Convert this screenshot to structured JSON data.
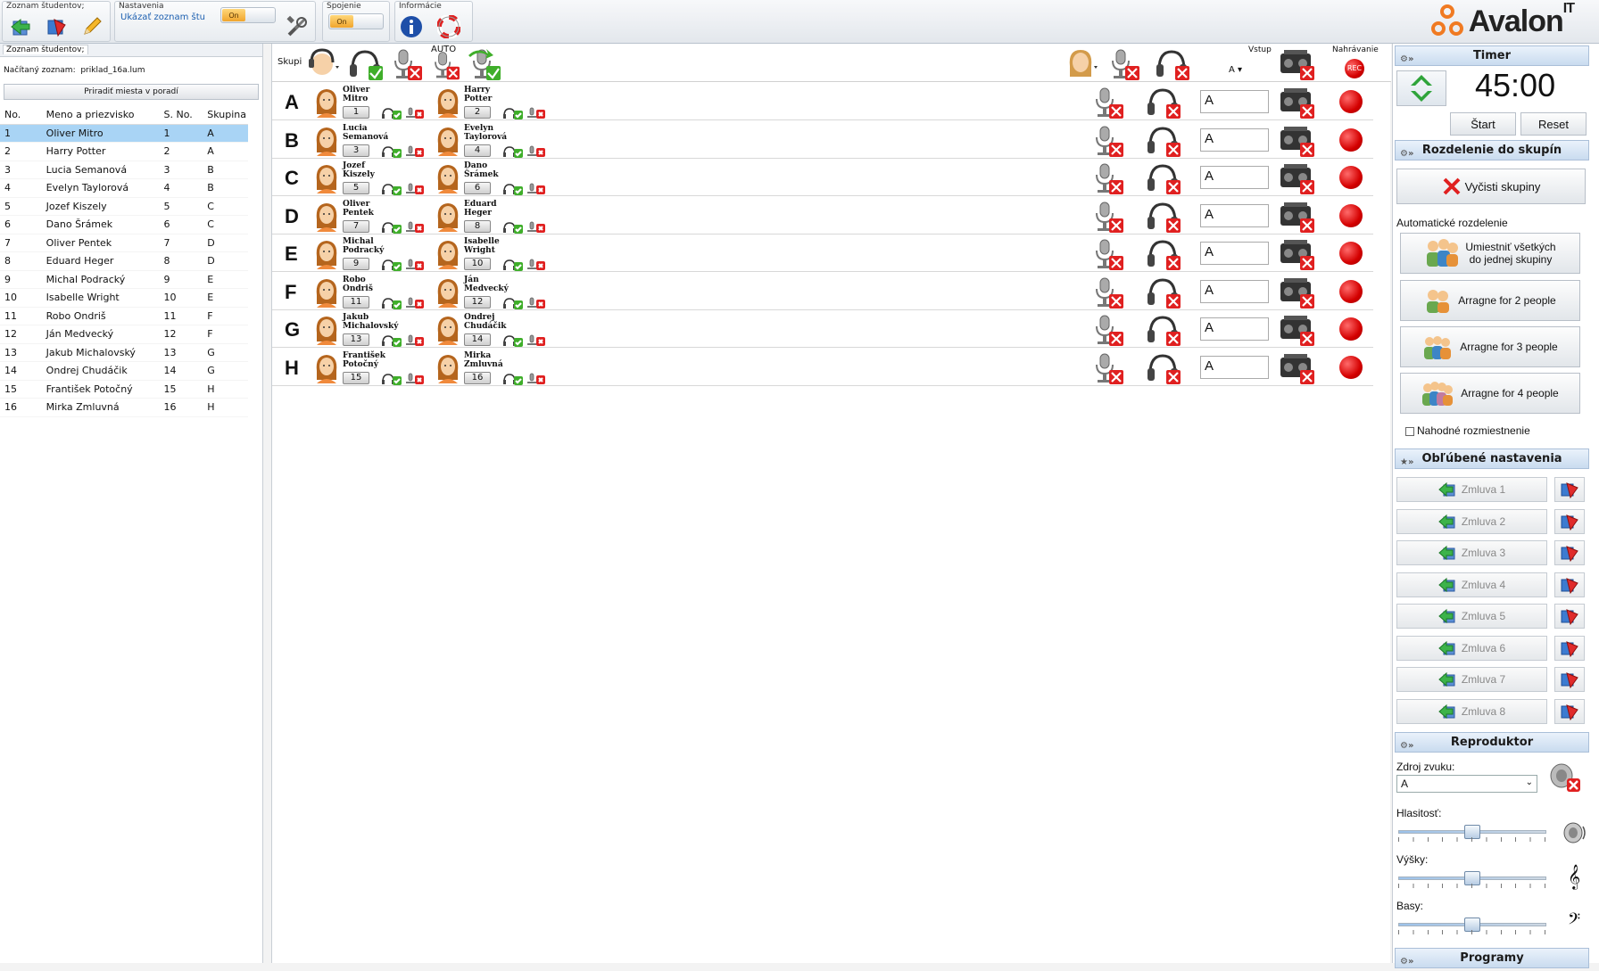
{
  "toolbar": {
    "students_group": "Zoznam študentov;",
    "settings_group": "Nastavenia",
    "show_list_label": "Ukázať zoznam štu",
    "toggle_on": "On",
    "connection_group": "Spojenie",
    "info_group": "Informácie"
  },
  "logo": {
    "text": "Avalon",
    "sup": "IT"
  },
  "left": {
    "tab": "Zoznam študentov;",
    "loaded_label": "Načítaný zoznam:",
    "loaded_file": "priklad_16a.lum",
    "arrange_button": "Priradiť miesta v poradí",
    "columns": [
      "No.",
      "Meno a priezvisko",
      "S. No.",
      "Skupina"
    ],
    "rows": [
      [
        "1",
        "Oliver Mitro",
        "1",
        "A"
      ],
      [
        "2",
        "Harry Potter",
        "2",
        "A"
      ],
      [
        "3",
        "Lucia Semanová",
        "3",
        "B"
      ],
      [
        "4",
        "Evelyn Taylorová",
        "4",
        "B"
      ],
      [
        "5",
        "Jozef Kiszely",
        "5",
        "C"
      ],
      [
        "6",
        "Dano Šrámek",
        "6",
        "C"
      ],
      [
        "7",
        "Oliver Pentek",
        "7",
        "D"
      ],
      [
        "8",
        "Eduard Heger",
        "8",
        "D"
      ],
      [
        "9",
        "Michal Podracký",
        "9",
        "E"
      ],
      [
        "10",
        "Isabelle Wright",
        "10",
        "E"
      ],
      [
        "11",
        "Robo Ondriš",
        "11",
        "F"
      ],
      [
        "12",
        "Ján Medvecký",
        "12",
        "F"
      ],
      [
        "13",
        "Jakub Michalovský",
        "13",
        "G"
      ],
      [
        "14",
        "Ondrej Chudáčik",
        "14",
        "G"
      ],
      [
        "15",
        "František Potočný",
        "15",
        "H"
      ],
      [
        "16",
        "Mirka Zmluvná",
        "16",
        "H"
      ]
    ]
  },
  "center": {
    "groups_label": "Skupi",
    "auto_label": "AUTO",
    "input_label": "Vstup",
    "input_value": "A",
    "recording_label": "Nahrávanie",
    "rec_text": "REC",
    "groups": [
      {
        "letter": "A",
        "a_name1": "Oliver",
        "a_name2": "Mitro",
        "a_num": "1",
        "b_name1": "Harry",
        "b_name2": "Potter",
        "b_num": "2",
        "input": "A"
      },
      {
        "letter": "B",
        "a_name1": "Lucia",
        "a_name2": "Semanová",
        "a_num": "3",
        "b_name1": "Evelyn",
        "b_name2": "Taylorová",
        "b_num": "4",
        "input": "A"
      },
      {
        "letter": "C",
        "a_name1": "Jozef",
        "a_name2": "Kiszely",
        "a_num": "5",
        "b_name1": "Dano",
        "b_name2": "Šrámek",
        "b_num": "6",
        "input": "A"
      },
      {
        "letter": "D",
        "a_name1": "Oliver",
        "a_name2": "Pentek",
        "a_num": "7",
        "b_name1": "Eduard",
        "b_name2": "Heger",
        "b_num": "8",
        "input": "A"
      },
      {
        "letter": "E",
        "a_name1": "Michal",
        "a_name2": "Podracký",
        "a_num": "9",
        "b_name1": "Isabelle",
        "b_name2": "Wright",
        "b_num": "10",
        "input": "A"
      },
      {
        "letter": "F",
        "a_name1": "Robo",
        "a_name2": "Ondriš",
        "a_num": "11",
        "b_name1": "Ján",
        "b_name2": "Medvecký",
        "b_num": "12",
        "input": "A"
      },
      {
        "letter": "G",
        "a_name1": "Jakub",
        "a_name2": "Michalovský",
        "a_num": "13",
        "b_name1": "Ondrej",
        "b_name2": "Chudáčik",
        "b_num": "14",
        "input": "A"
      },
      {
        "letter": "H",
        "a_name1": "František",
        "a_name2": "Potočný",
        "a_num": "15",
        "b_name1": "Mirka",
        "b_name2": "Zmluvná",
        "b_num": "16",
        "input": "A"
      }
    ]
  },
  "right": {
    "timer_title": "Timer",
    "timer_value": "45:00",
    "start": "Štart",
    "reset": "Reset",
    "groups_title": "Rozdelenie do skupín",
    "clear_groups": "Vyčisti skupiny",
    "auto_split": "Automatické rozdelenie",
    "all_one_line1": "Umiestniť všetkých",
    "all_one_line2": "do jednej skupiny",
    "arr2": "Arragne for 2 people",
    "arr3": "Arragne for 3 people",
    "arr4": "Arragne for 4 people",
    "random": "Nahodné rozmiestnenie",
    "fav_title": "Obľúbené nastavenia",
    "favs": [
      "Zmluva 1",
      "Zmluva 2",
      "Zmluva 3",
      "Zmluva 4",
      "Zmluva 5",
      "Zmluva 6",
      "Zmluva 7",
      "Zmluva 8"
    ],
    "speaker_title": "Reproduktor",
    "source_label": "Zdroj zvuku:",
    "source_value": "A",
    "volume": "Hlasitosť:",
    "treble": "Výšky:",
    "bass": "Basy:",
    "programs_title": "Programy"
  },
  "colors": {
    "accent": "#a9d4f5",
    "rec": "#d40000",
    "ok": "#3fae2a",
    "err": "#e02020"
  }
}
